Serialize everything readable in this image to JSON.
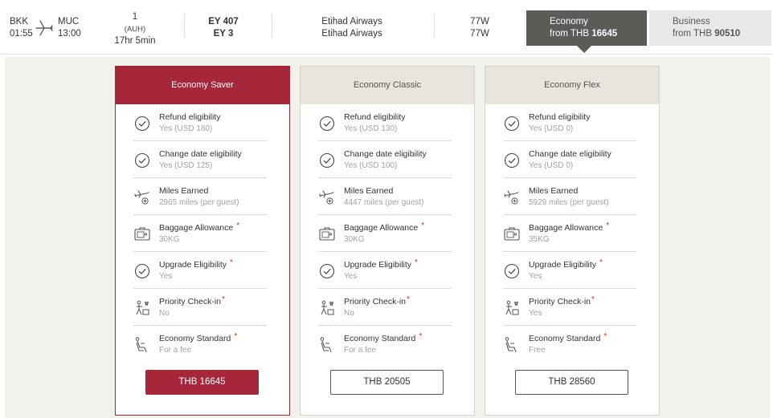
{
  "flight": {
    "origin_code": "BKK",
    "origin_time": "01:55",
    "dest_code": "MUC",
    "dest_time": "13:00",
    "stops_count": "1",
    "stops_via": "(AUH)",
    "duration": "17hr 5min",
    "flight_numbers": [
      "EY 407",
      "EY 3"
    ],
    "airlines": [
      "Etihad Airways",
      "Etihad Airways"
    ],
    "aircraft": [
      "77W",
      "77W"
    ],
    "plane_icon": "plane-icon"
  },
  "cabins": [
    {
      "name": "Economy",
      "from_prefix": "from THB",
      "price": "16645",
      "selected": true
    },
    {
      "name": "Business",
      "from_prefix": "from THB",
      "price": "90510",
      "selected": false
    }
  ],
  "fares": [
    {
      "name": "Economy Saver",
      "selected": true,
      "price_label": "THB 16645",
      "features": [
        {
          "icon": "check-circle-icon",
          "title": "Refund eligibility",
          "value": "Yes (USD 180)",
          "required": false
        },
        {
          "icon": "check-circle-icon",
          "title": "Change date eligibility",
          "value": "Yes (USD 125)",
          "required": false
        },
        {
          "icon": "miles-plane-icon",
          "title": "Miles Earned",
          "value": "2965 miles  (per guest)",
          "required": false
        },
        {
          "icon": "baggage-icon",
          "title": "Baggage Allowance",
          "value": "30KG",
          "required": true
        },
        {
          "icon": "check-circle-icon",
          "title": "Upgrade Eligibility",
          "value": "Yes",
          "required": true
        },
        {
          "icon": "priority-checkin-icon",
          "title": "Priority Check-in",
          "value": "No",
          "required": true
        },
        {
          "icon": "seat-icon",
          "title": "Economy Standard",
          "value": "For a fee",
          "required": true
        }
      ]
    },
    {
      "name": "Economy Classic",
      "selected": false,
      "price_label": "THB 20505",
      "features": [
        {
          "icon": "check-circle-icon",
          "title": "Refund eligibility",
          "value": "Yes (USD 130)",
          "required": false
        },
        {
          "icon": "check-circle-icon",
          "title": "Change date eligibility",
          "value": "Yes (USD 100)",
          "required": false
        },
        {
          "icon": "miles-plane-icon",
          "title": "Miles Earned",
          "value": "4447 miles  (per guest)",
          "required": false
        },
        {
          "icon": "baggage-icon",
          "title": "Baggage Allowance",
          "value": "30KG",
          "required": true
        },
        {
          "icon": "check-circle-icon",
          "title": "Upgrade Eligibility",
          "value": "Yes",
          "required": true
        },
        {
          "icon": "priority-checkin-icon",
          "title": "Priority Check-in",
          "value": "No",
          "required": true
        },
        {
          "icon": "seat-icon",
          "title": "Economy Standard",
          "value": "For a fee",
          "required": true
        }
      ]
    },
    {
      "name": "Economy Flex",
      "selected": false,
      "price_label": "THB 28560",
      "features": [
        {
          "icon": "check-circle-icon",
          "title": "Refund eligibility",
          "value": "Yes (USD 0)",
          "required": false
        },
        {
          "icon": "check-circle-icon",
          "title": "Change date eligibility",
          "value": "Yes (USD 0)",
          "required": false
        },
        {
          "icon": "miles-plane-icon",
          "title": "Miles Earned",
          "value": "5929 miles  (per guest)",
          "required": false
        },
        {
          "icon": "baggage-icon",
          "title": "Baggage Allowance",
          "value": "35KG",
          "required": true
        },
        {
          "icon": "check-circle-icon",
          "title": "Upgrade Eligibility",
          "value": "Yes",
          "required": true
        },
        {
          "icon": "priority-checkin-icon",
          "title": "Priority Check-in",
          "value": "Yes",
          "required": true
        },
        {
          "icon": "seat-icon",
          "title": "Economy Standard",
          "value": "Free",
          "required": true
        }
      ]
    }
  ],
  "required_mark": "*",
  "colors": {
    "accent": "#a6263a",
    "tab_active": "#5d5b58",
    "tab_inactive": "#e8e8e8",
    "area_bg": "#f2f1ec",
    "card_head": "#e9e5dc"
  }
}
